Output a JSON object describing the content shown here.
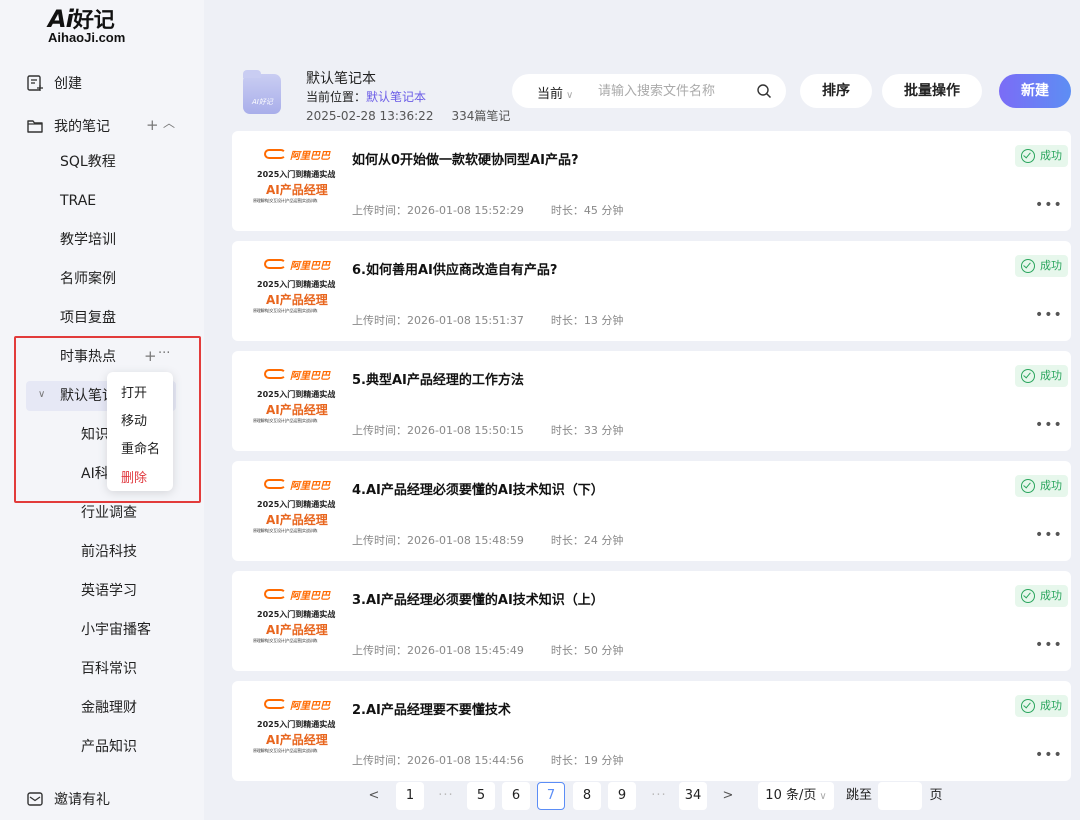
{
  "logo": {
    "ai": "Ai",
    "name": "好记",
    "domain": "AihaoJi.com"
  },
  "sidebar": {
    "create": "创建",
    "my_notes": "我的笔记",
    "notes": [
      "SQL教程",
      "TRAE",
      "教学培训",
      "名师案例",
      "项目复盘",
      "时事热点"
    ],
    "default_folder": "默认笔记本",
    "default_children": [
      "知识",
      "AI科",
      "行业调查",
      "前沿科技",
      "英语学习",
      "小宇宙播客",
      "百科常识",
      "金融理财",
      "产品知识"
    ],
    "invite": "邀请有礼",
    "context_menu": {
      "open": "打开",
      "move": "移动",
      "rename": "重命名",
      "delete": "删除"
    }
  },
  "header": {
    "title": "默认笔记本",
    "location_label": "当前位置：",
    "location_value": "默认笔记本",
    "timestamp": "2025-02-28 13:36:22",
    "count": "334篇笔记",
    "folder_icon_text": "AI好记"
  },
  "search": {
    "scope": "当前",
    "placeholder": "请输入搜索文件名称"
  },
  "toolbar": {
    "sort": "排序",
    "batch": "批量操作",
    "new": "新建"
  },
  "thumbnail": {
    "brand": "阿里巴巴",
    "line1": "2025入门到精通实战",
    "line2": "AI产品经理",
    "line3": "原理解构|交互设计|产品运营|实战训练"
  },
  "notes": [
    {
      "title": "如何从0开始做一款软硬协同型AI产品?",
      "uploaded": "上传时间：2026-01-08 15:52:29",
      "duration": "时长：45 分钟",
      "status": "成功"
    },
    {
      "title": "6.如何善用AI供应商改造自有产品?",
      "uploaded": "上传时间：2026-01-08 15:51:37",
      "duration": "时长：13 分钟",
      "status": "成功"
    },
    {
      "title": "5.典型AI产品经理的工作方法",
      "uploaded": "上传时间：2026-01-08 15:50:15",
      "duration": "时长：33 分钟",
      "status": "成功"
    },
    {
      "title": "4.AI产品经理必须要懂的AI技术知识（下）",
      "uploaded": "上传时间：2026-01-08 15:48:59",
      "duration": "时长：24 分钟",
      "status": "成功"
    },
    {
      "title": "3.AI产品经理必须要懂的AI技术知识（上）",
      "uploaded": "上传时间：2026-01-08 15:45:49",
      "duration": "时长：50 分钟",
      "status": "成功"
    },
    {
      "title": "2.AI产品经理要不要懂技术",
      "uploaded": "上传时间：2026-01-08 15:44:56",
      "duration": "时长：19 分钟",
      "status": "成功"
    }
  ],
  "pagination": {
    "prev": "<",
    "next": ">",
    "pages": [
      "1",
      "5",
      "6",
      "7",
      "8",
      "9",
      "34"
    ],
    "ellipsis": "···",
    "current": "7",
    "page_size": "10 条/页",
    "goto_label": "跳至",
    "goto_suffix": "页"
  }
}
